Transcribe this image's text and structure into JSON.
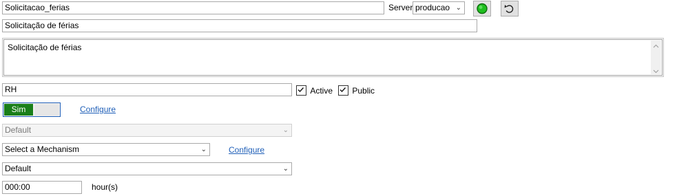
{
  "header": {
    "process_name": "Solicitacao_ferias",
    "server_label": "Server",
    "server_value": "producao",
    "status_icon": "green-circle-icon",
    "reset_icon": "undo-icon"
  },
  "form": {
    "title": "Solicitação de férias",
    "description": "Solicitação de férias",
    "category": "RH",
    "active_label": "Active",
    "active_checked": true,
    "public_label": "Public",
    "public_checked": true,
    "toggle_label": "Sim",
    "toggle_on": true,
    "configure_1": "Configure",
    "default_select_disabled": "Default",
    "mechanism_select": "Select a Mechanism",
    "configure_2": "Configure",
    "default_select": "Default",
    "time_value": "000:00",
    "time_unit": "hour(s)"
  },
  "colors": {
    "status_green": "#1fbf1f",
    "toggle_green": "#1a7f1a",
    "link_blue": "#1f5fb8"
  }
}
